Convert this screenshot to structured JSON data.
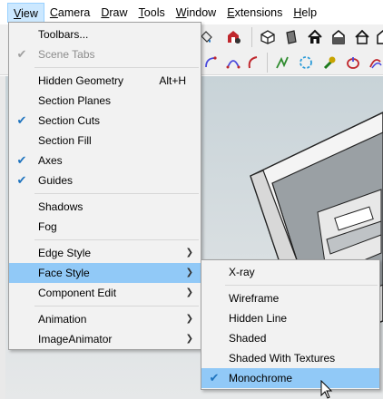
{
  "menubar": {
    "items": [
      {
        "label": "View",
        "ul": "V",
        "rest": "iew",
        "active": true
      },
      {
        "label": "Camera",
        "ul": "C",
        "rest": "amera"
      },
      {
        "label": "Draw",
        "ul": "D",
        "rest": "raw"
      },
      {
        "label": "Tools",
        "ul": "T",
        "rest": "ools"
      },
      {
        "label": "Window",
        "ul": "W",
        "rest": "indow"
      },
      {
        "label": "Extensions",
        "ul": "E",
        "rest": "xtensions"
      },
      {
        "label": "Help",
        "ul": "H",
        "rest": "elp"
      }
    ]
  },
  "view_menu": {
    "toolbars": "Toolbars...",
    "scene_tabs": "Scene Tabs",
    "hidden_geometry": "Hidden Geometry",
    "hidden_geometry_shortcut": "Alt+H",
    "section_planes": "Section Planes",
    "section_cuts": "Section Cuts",
    "section_fill": "Section Fill",
    "axes": "Axes",
    "guides": "Guides",
    "shadows": "Shadows",
    "fog": "Fog",
    "edge_style": "Edge Style",
    "face_style": "Face Style",
    "component_edit": "Component Edit",
    "animation": "Animation",
    "image_animator": "ImageAnimator"
  },
  "face_style_menu": {
    "xray": "X-ray",
    "wireframe": "Wireframe",
    "hidden_line": "Hidden Line",
    "shaded": "Shaded",
    "shaded_with_textures": "Shaded With Textures",
    "monochrome": "Monochrome"
  },
  "glyphs": {
    "check": "✔",
    "arrow": "❯"
  },
  "colors": {
    "menu_highlight": "#91c9f7",
    "menubar_active": "#cce8ff",
    "check_blue": "#1e73be"
  }
}
